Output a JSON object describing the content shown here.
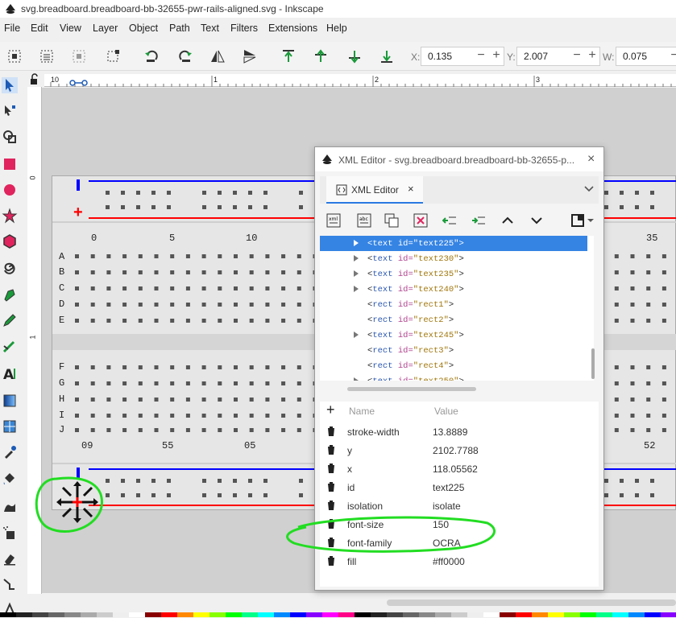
{
  "window": {
    "title": "svg.breadboard.breadboard-bb-32655-pwr-rails-aligned.svg - Inkscape"
  },
  "menu": [
    "File",
    "Edit",
    "View",
    "Layer",
    "Object",
    "Path",
    "Text",
    "Filters",
    "Extensions",
    "Help"
  ],
  "toolbar": {
    "x_label": "X:",
    "x_value": "0.135",
    "y_label": "Y:",
    "y_value": "2.007",
    "w_label": "W:",
    "w_value": "0.075",
    "minus": "−",
    "plus": "+"
  },
  "ruler_top": [
    "10",
    "1",
    "2",
    "3"
  ],
  "ruler_left": [
    "0",
    "1"
  ],
  "breadboard": {
    "columns_top": [
      "0",
      "5",
      "10",
      "35"
    ],
    "columns_bottom": [
      "09",
      "55",
      "05",
      "52"
    ],
    "rows_top": [
      "A",
      "B",
      "C",
      "D",
      "E"
    ],
    "rows_bottom": [
      "F",
      "G",
      "H",
      "I",
      "J"
    ],
    "plus_sign": "+",
    "rail_colors": {
      "positive": "#ff0000",
      "negative": "#0000ff"
    }
  },
  "xml_editor": {
    "title": "XML Editor - svg.breadboard.breadboard-bb-32655-p...",
    "close": "×",
    "tab_label": "XML Editor",
    "tab_close": "×",
    "tab_menu": "⌄",
    "tree": [
      {
        "el": "text",
        "id": "text225",
        "expandable": true,
        "selected": true
      },
      {
        "el": "text",
        "id": "text230",
        "expandable": true
      },
      {
        "el": "text",
        "id": "text235",
        "expandable": true
      },
      {
        "el": "text",
        "id": "text240",
        "expandable": true
      },
      {
        "el": "rect",
        "id": "rect1",
        "expandable": false
      },
      {
        "el": "rect",
        "id": "rect2",
        "expandable": false
      },
      {
        "el": "text",
        "id": "text245",
        "expandable": true
      },
      {
        "el": "rect",
        "id": "rect3",
        "expandable": false
      },
      {
        "el": "rect",
        "id": "rect4",
        "expandable": false
      },
      {
        "el": "text",
        "id": "text250",
        "expandable": true
      }
    ],
    "attr_header": {
      "add": "+",
      "name": "Name",
      "value": "Value"
    },
    "attributes": [
      {
        "name": "stroke-width",
        "value": "13.8889"
      },
      {
        "name": "y",
        "value": "2102.7788"
      },
      {
        "name": "x",
        "value": "118.05562"
      },
      {
        "name": "id",
        "value": "text225"
      },
      {
        "name": "isolation",
        "value": "isolate"
      },
      {
        "name": "font-size",
        "value": "150"
      },
      {
        "name": "font-family",
        "value": "OCRA"
      },
      {
        "name": "fill",
        "value": "#ff0000"
      }
    ]
  },
  "annotation_color": "#22dd22"
}
